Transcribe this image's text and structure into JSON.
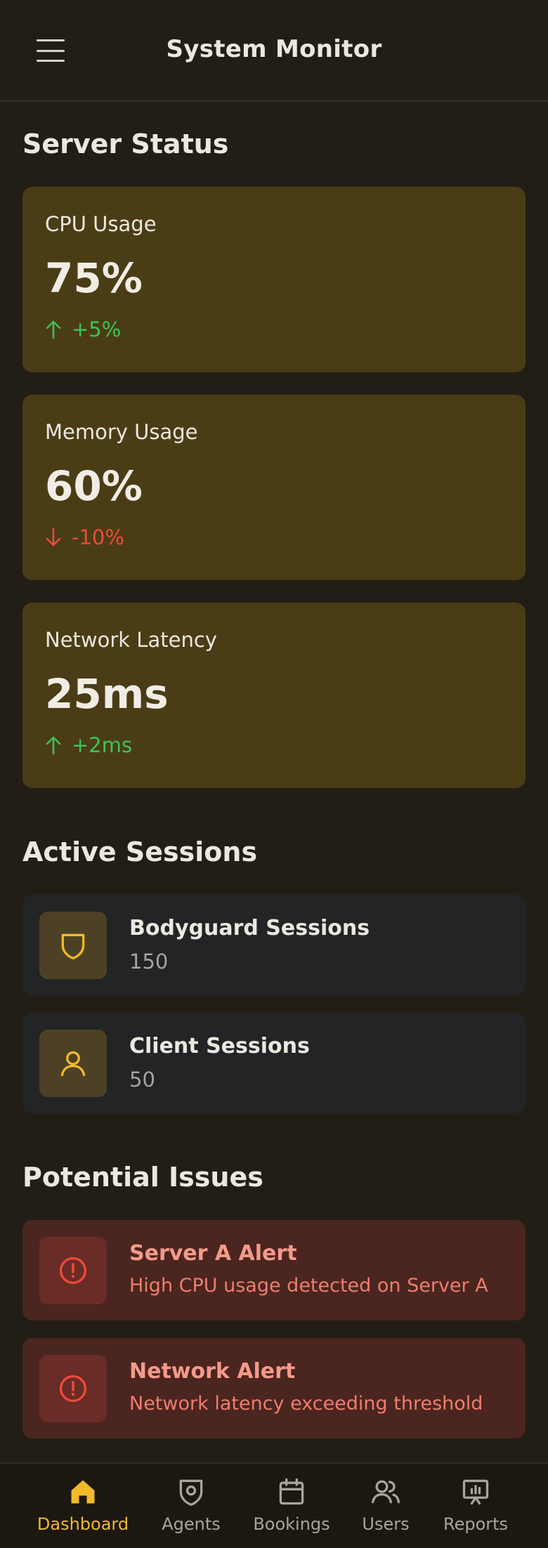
{
  "header": {
    "title": "System Monitor",
    "menu_icon": "hamburger-menu-icon"
  },
  "server_status": {
    "title": "Server Status",
    "metrics": [
      {
        "label": "CPU Usage",
        "value": "75%",
        "delta": "+5%",
        "direction": "up",
        "delta_color": "#3cc35a"
      },
      {
        "label": "Memory Usage",
        "value": "60%",
        "delta": "-10%",
        "direction": "down",
        "delta_color": "#ef4a3a"
      },
      {
        "label": "Network Latency",
        "value": "25ms",
        "delta": "+2ms",
        "direction": "up",
        "delta_color": "#3cc35a"
      }
    ]
  },
  "active_sessions": {
    "title": "Active Sessions",
    "items": [
      {
        "title": "Bodyguard Sessions",
        "count": "150",
        "icon": "shield-icon"
      },
      {
        "title": "Client Sessions",
        "count": "50",
        "icon": "user-icon"
      }
    ]
  },
  "potential_issues": {
    "title": "Potential Issues",
    "items": [
      {
        "title": "Server A Alert",
        "message": "High CPU usage detected on Server A",
        "icon": "alert-circle-icon"
      },
      {
        "title": "Network Alert",
        "message": "Network latency exceeding threshold",
        "icon": "alert-circle-icon"
      }
    ]
  },
  "bottom_nav": {
    "items": [
      {
        "label": "Dashboard",
        "icon": "home-icon",
        "active": true
      },
      {
        "label": "Agents",
        "icon": "shield-icon",
        "active": false
      },
      {
        "label": "Bookings",
        "icon": "calendar-icon",
        "active": false
      },
      {
        "label": "Users",
        "icon": "users-icon",
        "active": false
      },
      {
        "label": "Reports",
        "icon": "presentation-chart-icon",
        "active": false
      }
    ]
  },
  "colors": {
    "background": "#221e16",
    "accent": "#f2b92b",
    "metric_card": "#4a3d16",
    "session_card": "#222425",
    "alert_card": "#4b2520",
    "positive": "#3cc35a",
    "negative": "#ef4a3a"
  }
}
